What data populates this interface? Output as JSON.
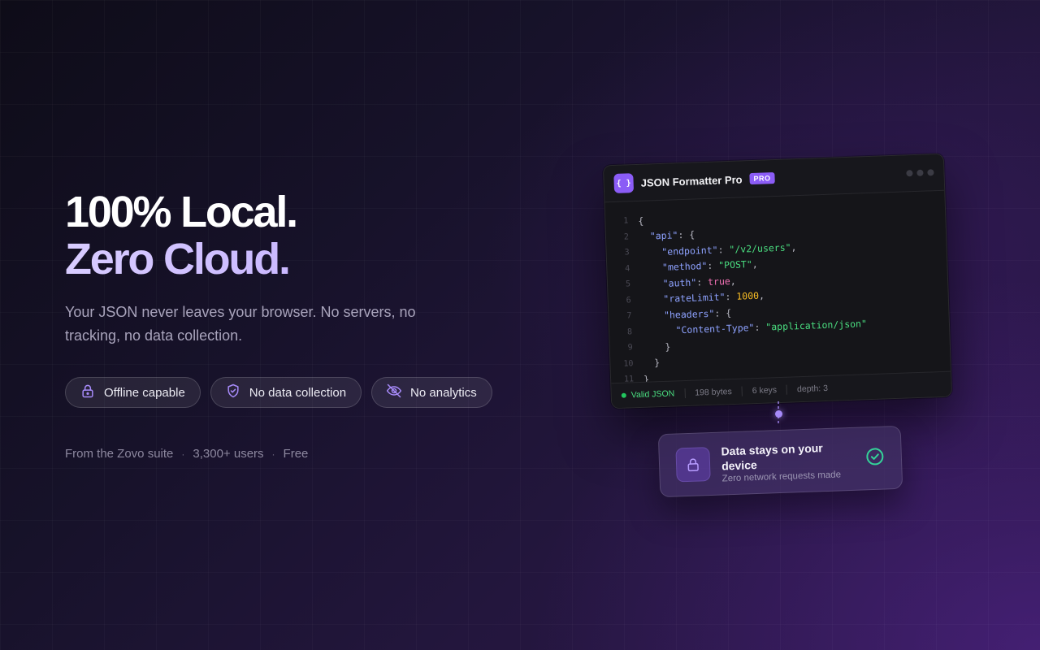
{
  "hero": {
    "headline_line1": "100% Local.",
    "headline_line2": "Zero Cloud.",
    "subtitle": "Your JSON never leaves your browser. No servers, no tracking, no data collection.",
    "pills": [
      {
        "label": "Offline capable",
        "icon": "lock-icon"
      },
      {
        "label": "No data collection",
        "icon": "shield-check-icon"
      },
      {
        "label": "No analytics",
        "icon": "eye-off-icon"
      }
    ],
    "meta": {
      "suite": "From the Zovo suite",
      "users": "3,300+ users",
      "price": "Free",
      "separator": "·"
    }
  },
  "editor": {
    "icon_glyph": "{ }",
    "title": "JSON Formatter Pro",
    "badge": "PRO",
    "line_numbers": [
      "1",
      "2",
      "3",
      "4",
      "5",
      "6",
      "7",
      "8",
      "9",
      "10",
      "11"
    ],
    "footer": {
      "status": "Valid JSON",
      "bytes": "198 bytes",
      "keys": "6 keys",
      "depth": "depth: 3"
    }
  },
  "privacy_card": {
    "title": "Data stays on your device",
    "subtitle": "Zero network requests made"
  },
  "colors": {
    "accent": "#8b5cf6",
    "json_key": "#8ea2ff",
    "json_string": "#4ade80",
    "json_boolean": "#f472b6",
    "json_number": "#fbbf24",
    "valid_green": "#22c55e"
  }
}
